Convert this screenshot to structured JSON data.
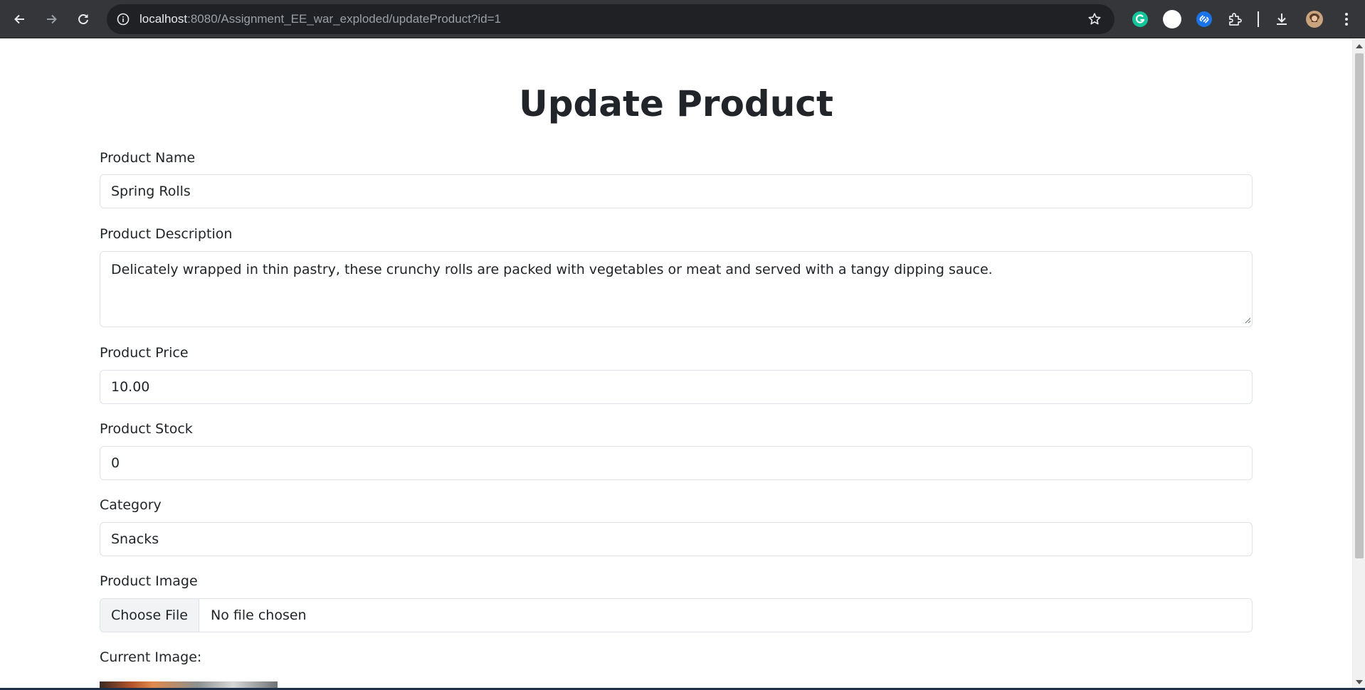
{
  "browser": {
    "url_host": "localhost",
    "url_rest": ":8080/Assignment_EE_war_exploded/updateProduct?id=1"
  },
  "page": {
    "title": "Update Product"
  },
  "form": {
    "name_label": "Product Name",
    "name_value": "Spring Rolls",
    "description_label": "Product Description",
    "description_value": "Delicately wrapped in thin pastry, these crunchy rolls are packed with vegetables or meat and served with a tangy dipping sauce.",
    "price_label": "Product Price",
    "price_value": "10.00",
    "stock_label": "Product Stock",
    "stock_value": "0",
    "category_label": "Category",
    "category_value": "Snacks",
    "image_label": "Product Image",
    "choose_file_label": "Choose File",
    "file_status": "No file chosen",
    "current_image_label": "Current Image:"
  },
  "icons": {
    "back": "arrow-left-icon",
    "forward": "arrow-right-icon",
    "reload": "reload-icon",
    "site_info": "info-icon",
    "bookmark": "star-icon",
    "grammarly": "grammarly-icon",
    "profile_circle": "circle-icon",
    "shazam": "shazam-icon",
    "extensions": "puzzle-icon",
    "downloads": "download-icon",
    "avatar": "avatar-icon",
    "menu": "kebab-menu-icon"
  },
  "colors": {
    "chrome_bg": "#35363a",
    "omnibox_bg": "#202124",
    "text": "#212529",
    "border": "#dee2e6",
    "grammarly_green": "#15c39a",
    "shazam_blue": "#1a73e8"
  }
}
